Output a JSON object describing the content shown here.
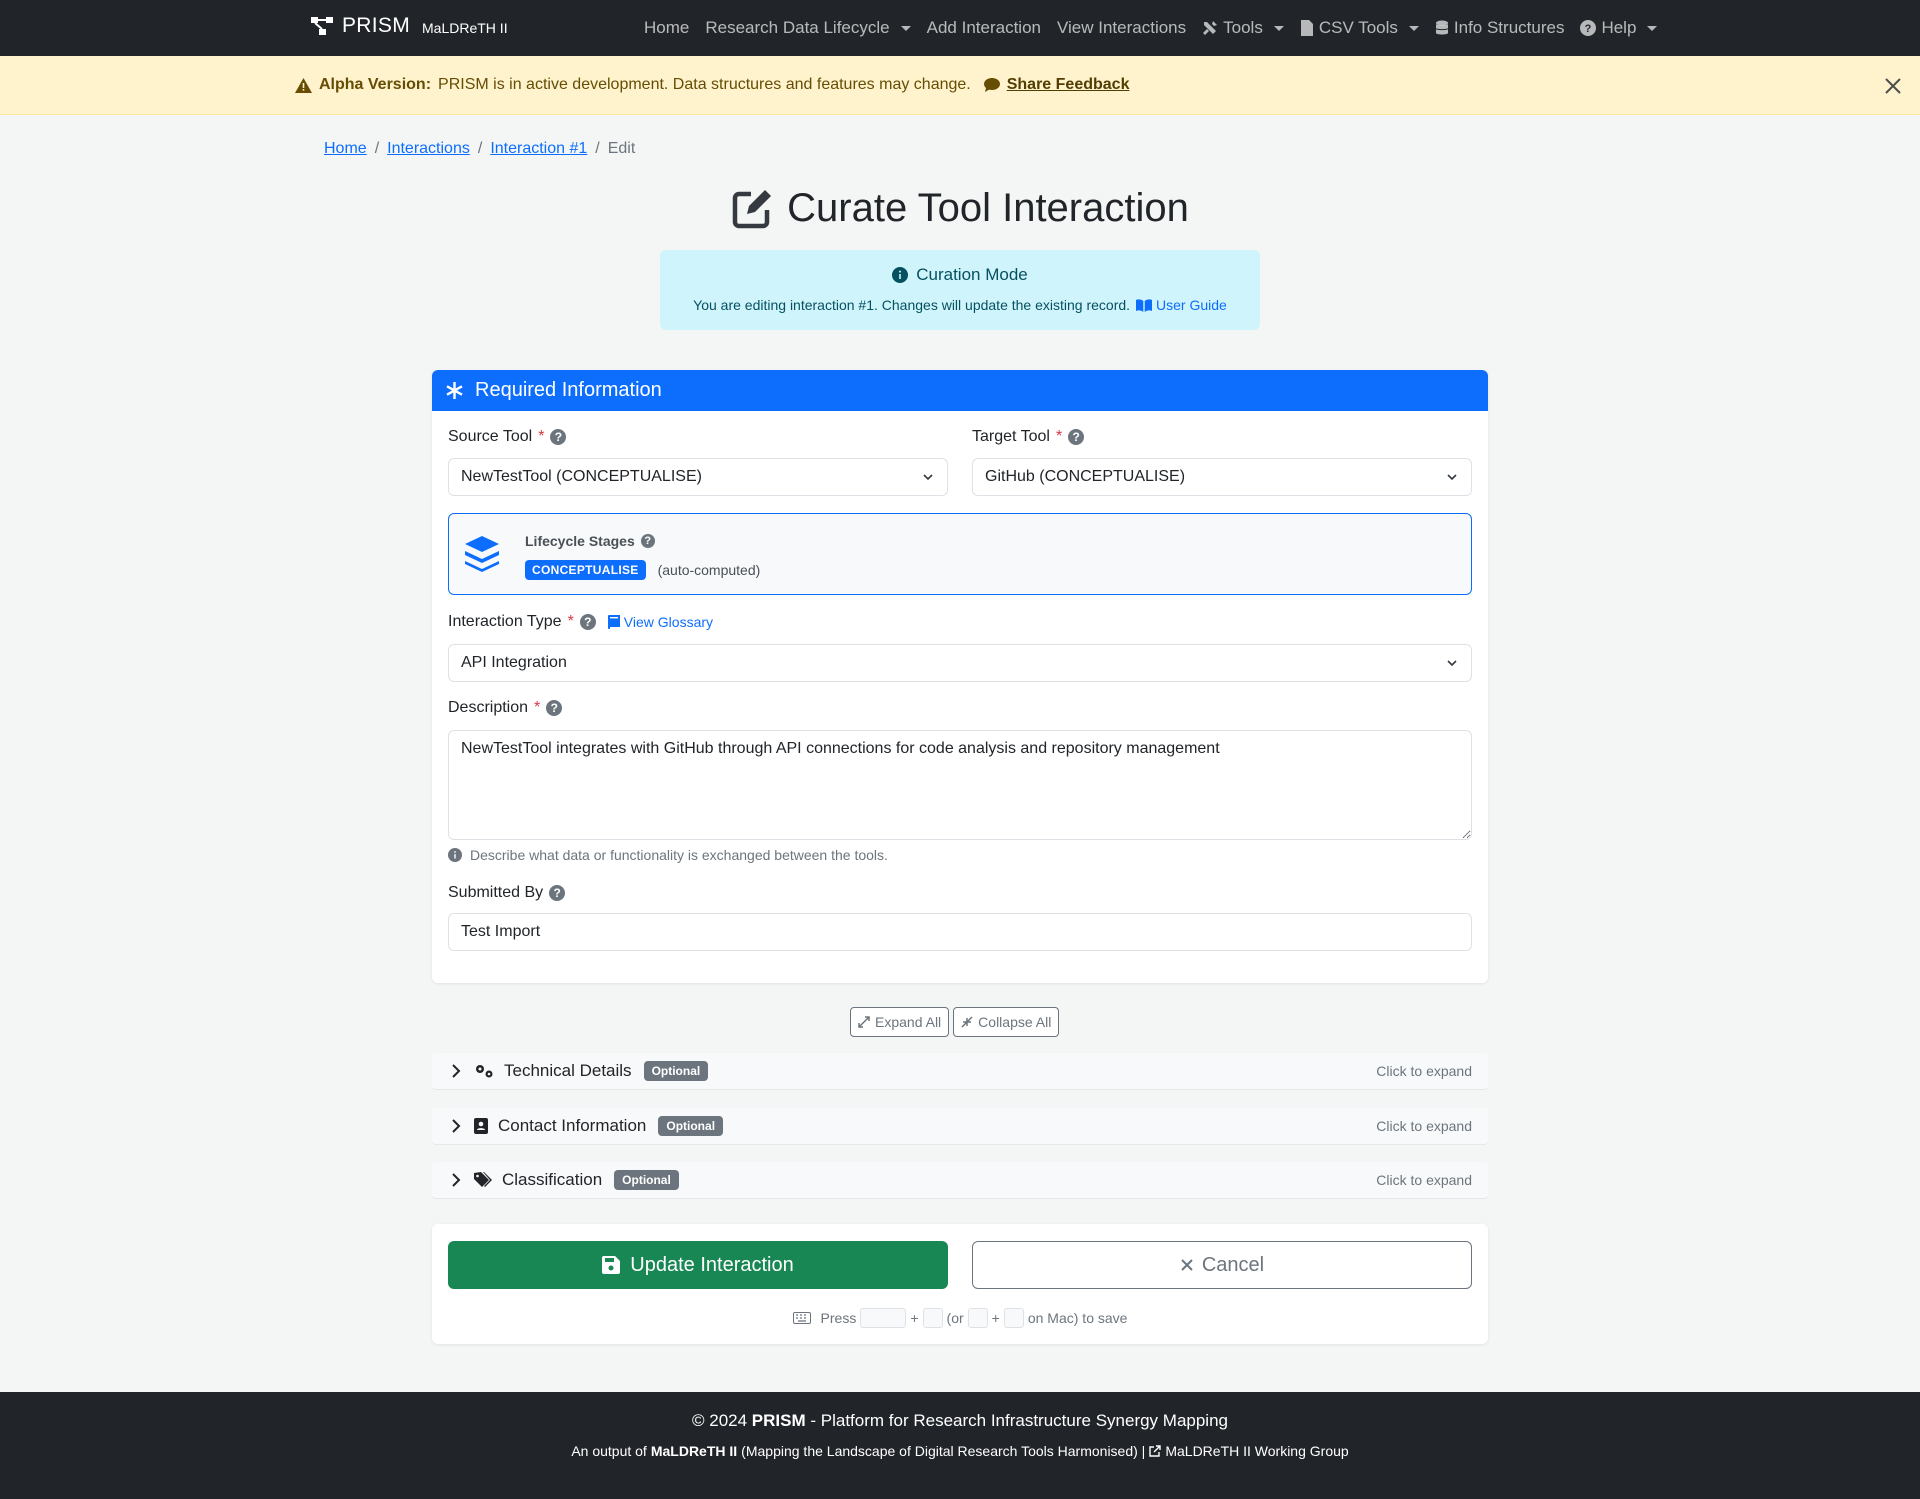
{
  "navbar": {
    "brand": "PRISM",
    "brand_sub": "MaLDReTH II",
    "items": [
      {
        "label": "Home",
        "dropdown": false
      },
      {
        "label": "Research Data Lifecycle",
        "dropdown": true
      },
      {
        "label": "Add Interaction",
        "dropdown": false
      },
      {
        "label": "View Interactions",
        "dropdown": false
      },
      {
        "label": "Tools",
        "dropdown": true
      },
      {
        "label": "CSV Tools",
        "dropdown": true
      },
      {
        "label": "Info Structures",
        "dropdown": false
      },
      {
        "label": "Help",
        "dropdown": true
      }
    ]
  },
  "alert": {
    "title": "Alpha Version:",
    "text": "PRISM is in active development. Data structures and features may change.",
    "link": "Share Feedback"
  },
  "breadcrumb": [
    "Home",
    "Interactions",
    "Interaction #1",
    "Edit"
  ],
  "page_title": "Curate Tool Interaction",
  "curation": {
    "heading": "Curation Mode",
    "text": "You are editing interaction #1. Changes will update the existing record.",
    "link": "User Guide"
  },
  "form": {
    "header": "Required Information",
    "source_label": "Source Tool",
    "source_value": "NewTestTool (CONCEPTUALISE)",
    "target_label": "Target Tool",
    "target_value": "GitHub (CONCEPTUALISE)",
    "lifecycle_label": "Lifecycle Stages",
    "lifecycle_badge": "CONCEPTUALISE",
    "lifecycle_note": "(auto-computed)",
    "type_label": "Interaction Type",
    "glossary_link": "View Glossary",
    "type_value": "API Integration",
    "desc_label": "Description",
    "desc_value": "NewTestTool integrates with GitHub through API connections for code analysis and repository management",
    "desc_hint": "Describe what data or functionality is exchanged between the tools.",
    "submitted_label": "Submitted By",
    "submitted_value": "Test Import"
  },
  "toggles": {
    "expand": "Expand All",
    "collapse": "Collapse All"
  },
  "sections": [
    {
      "title": "Technical Details",
      "badge": "Optional",
      "hint": "Click to expand",
      "icon": "gears-icon"
    },
    {
      "title": "Contact Information",
      "badge": "Optional",
      "hint": "Click to expand",
      "icon": "contact-card-icon"
    },
    {
      "title": "Classification",
      "badge": "Optional",
      "hint": "Click to expand",
      "icon": "tags-icon"
    }
  ],
  "actions": {
    "update": "Update Interaction",
    "cancel": "Cancel",
    "shortcut_press": "Press",
    "shortcut_or": "(or",
    "shortcut_mac": "on Mac) to save"
  },
  "footer": {
    "line1_prefix": "© 2024",
    "line1_brand": "PRISM",
    "line1_rest": "- Platform for Research Infrastructure Synergy Mapping",
    "line2_prefix": "An output of",
    "line2_brand": "MaLDReTH II",
    "line2_rest": "(Mapping the Landscape of Digital Research Tools Harmonised) |",
    "line2_link": "MaLDReTH II Working Group"
  },
  "colors": {
    "primary": "#0d6efd",
    "success": "#198754",
    "navbar": "#212529",
    "alert_bg": "#fff3cd",
    "info_bg": "#cff4fc"
  }
}
